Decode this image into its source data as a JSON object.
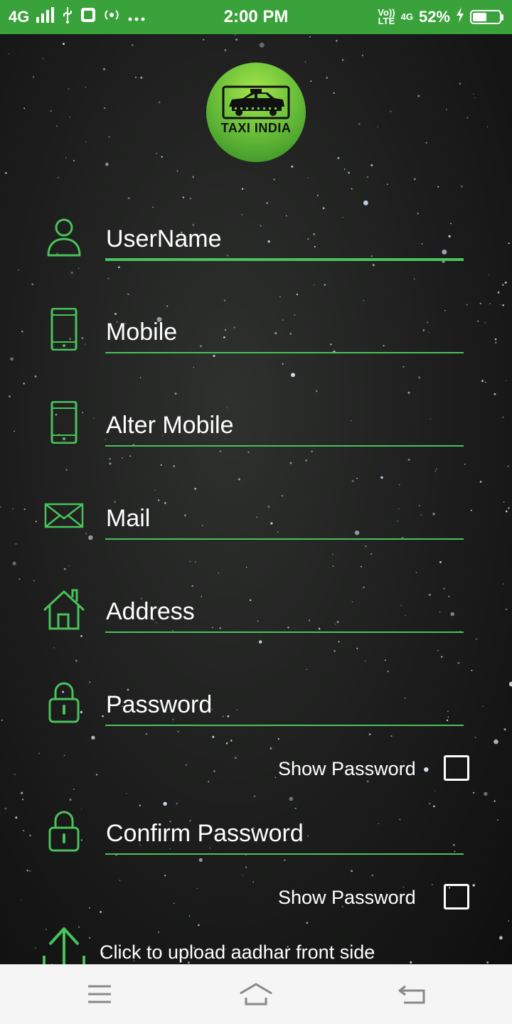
{
  "status_bar": {
    "network": "4G",
    "time": "2:00 PM",
    "volte_top": "Vo))",
    "volte_bottom": "LTE",
    "network2": "4G",
    "battery": "52%",
    "battery_level": 0.52,
    "icons": [
      "signal-icon",
      "usb-icon",
      "app-notification-icon",
      "hotspot-icon",
      "more-icon",
      "charging-icon",
      "battery-icon"
    ]
  },
  "logo": {
    "text": "TAXI INDIA",
    "icon": "taxi-icon"
  },
  "form": {
    "fields": [
      {
        "icon": "user-icon",
        "placeholder": "UserName",
        "value": ""
      },
      {
        "icon": "mobile-icon",
        "placeholder": "Mobile",
        "value": ""
      },
      {
        "icon": "mobile-icon",
        "placeholder": "Alter Mobile",
        "value": ""
      },
      {
        "icon": "mail-icon",
        "placeholder": "Mail",
        "value": ""
      },
      {
        "icon": "home-icon",
        "placeholder": "Address",
        "value": ""
      },
      {
        "icon": "lock-icon",
        "placeholder": "Password",
        "value": ""
      },
      {
        "icon": "lock-icon",
        "placeholder": "Confirm Password",
        "value": ""
      }
    ],
    "show_password_label": "Show Password",
    "show_password_checked": false,
    "show_confirm_password_label": "Show Password",
    "show_confirm_password_checked": false,
    "upload_label": "Click to upload aadhar front side",
    "upload_icon": "upload-icon"
  },
  "nav_bar": {
    "icons": [
      "menu-icon",
      "home-icon",
      "back-icon"
    ]
  },
  "colors": {
    "status_bar": "#3aa23a",
    "accent": "#49c25a",
    "nav_bar": "#f5f5f5"
  }
}
